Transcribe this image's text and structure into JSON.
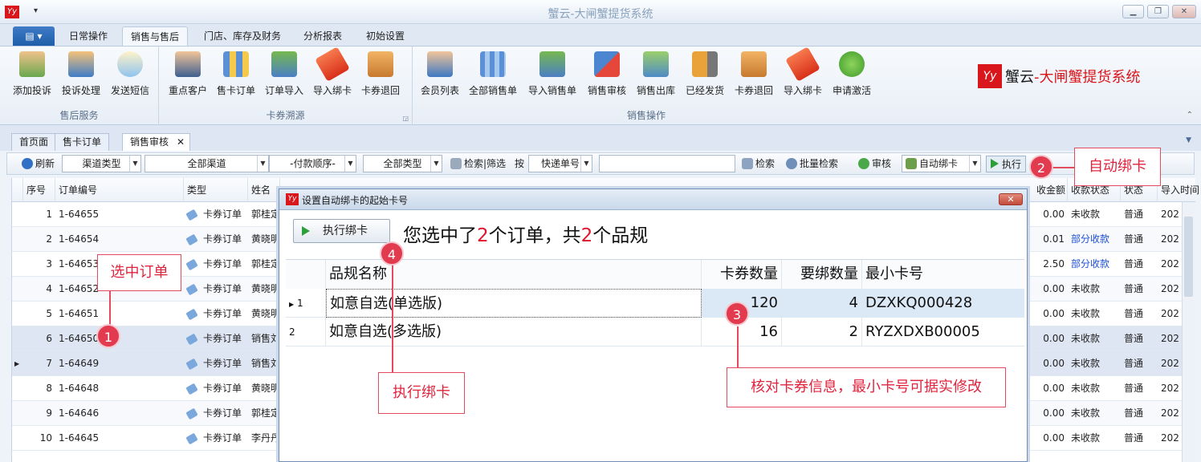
{
  "window": {
    "title": "蟹云-大闸蟹提货系统",
    "logo_text": "Yy",
    "qa": "▾"
  },
  "window_controls": {
    "minimize": "▁",
    "restore": "❐",
    "close": "✕"
  },
  "ribbon_tabs": [
    {
      "label": "日常操作"
    },
    {
      "label": "销售与售后"
    },
    {
      "label": "门店、库存及财务"
    },
    {
      "label": "分析报表"
    },
    {
      "label": "初始设置"
    }
  ],
  "menu_label": "▤ ▾",
  "groups": {
    "aftersale": {
      "title": "售后服务",
      "buttons": [
        "添加投诉",
        "投诉处理",
        "发送短信"
      ]
    },
    "source": {
      "title": "卡券溯源",
      "buttons": [
        "重点客户",
        "售卡订单",
        "订单导入",
        "导入绑卡",
        "卡券退回"
      ]
    },
    "sales": {
      "title": "销售操作",
      "buttons": [
        "会员列表",
        "全部销售单",
        "导入销售单",
        "销售审核",
        "销售出库",
        "已经发货",
        "卡券退回",
        "导入绑卡",
        "申请激活"
      ]
    }
  },
  "brand": {
    "main": "蟹云",
    "sub": "-大闸蟹提货系统"
  },
  "doc_tabs": [
    "首页面",
    "售卡订单",
    "销售审核"
  ],
  "toolbar": {
    "refresh": "刷新",
    "channel_type": "渠道类型",
    "all_channels": "全部渠道",
    "payment_order": "-付款顺序-",
    "all_types": "全部类型",
    "search_filter": "检索|筛选",
    "by": "按",
    "express_no": "快递单号",
    "search": "检索",
    "batch_search": "批量检索",
    "audit": "审核",
    "auto_bind": "自动绑卡",
    "execute": "执行"
  },
  "grid": {
    "headers": {
      "seq": "序号",
      "order_no": "订单编号",
      "type": "类型",
      "name": "姓名",
      "amount": "收金额",
      "collect_status": "收款状态",
      "status": "状态",
      "import_time": "导入时间"
    },
    "rows": [
      {
        "seq": "1",
        "order_no": "1-64655",
        "type": "卡券订单",
        "name": "郭桂定",
        "amount": "0.00",
        "collect": "未收款",
        "status": "普通",
        "time": "202"
      },
      {
        "seq": "2",
        "order_no": "1-64654",
        "type": "卡券订单",
        "name": "黄晓明",
        "amount": "0.01",
        "collect": "部分收款",
        "status": "普通",
        "time": "202"
      },
      {
        "seq": "3",
        "order_no": "1-64653",
        "type": "卡券订单",
        "name": "郭桂定",
        "amount": "2.50",
        "collect": "部分收款",
        "status": "普通",
        "time": "202"
      },
      {
        "seq": "4",
        "order_no": "1-64652",
        "type": "卡券订单",
        "name": "黄晓明",
        "amount": "0.00",
        "collect": "未收款",
        "status": "普通",
        "time": "202"
      },
      {
        "seq": "5",
        "order_no": "1-64651",
        "type": "卡券订单",
        "name": "黄晓明",
        "amount": "0.00",
        "collect": "未收款",
        "status": "普通",
        "time": "202"
      },
      {
        "seq": "6",
        "order_no": "1-64650",
        "type": "卡券订单",
        "name": "销售刘",
        "amount": "0.00",
        "collect": "未收款",
        "status": "普通",
        "time": "202"
      },
      {
        "seq": "7",
        "order_no": "1-64649",
        "type": "卡券订单",
        "name": "销售刘",
        "amount": "0.00",
        "collect": "未收款",
        "status": "普通",
        "time": "202"
      },
      {
        "seq": "8",
        "order_no": "1-64648",
        "type": "卡券订单",
        "name": "黄晓明",
        "amount": "0.00",
        "collect": "未收款",
        "status": "普通",
        "time": "202"
      },
      {
        "seq": "9",
        "order_no": "1-64646",
        "type": "卡券订单",
        "name": "郭桂定",
        "amount": "0.00",
        "collect": "未收款",
        "status": "普通",
        "time": "202"
      },
      {
        "seq": "10",
        "order_no": "1-64645",
        "type": "卡券订单",
        "name": "李丹丹",
        "amount": "0.00",
        "collect": "未收款",
        "status": "普通",
        "time": "202"
      }
    ]
  },
  "dialog": {
    "title": "设置自动绑卡的起始卡号",
    "close": "✕",
    "exec_button": "执行绑卡",
    "msg_prefix": "您选中了",
    "order_count": "2",
    "msg_mid": "个订单，共",
    "spec_count": "2",
    "msg_suffix": "个品规",
    "headers": {
      "name": "品规名称",
      "qty": "卡券数量",
      "bind": "要绑数量",
      "min": "最小卡号"
    },
    "rows": [
      {
        "idx": "1",
        "name": "如意自选(单选版)",
        "qty": "120",
        "bind": "4",
        "min": "DZXKQ000428"
      },
      {
        "idx": "2",
        "name": "如意自选(多选版)",
        "qty": "16",
        "bind": "2",
        "min": "RYZXDXB00005"
      }
    ]
  },
  "annotations": {
    "select_order": "选中订单",
    "auto_bind": "自动绑卡",
    "exec_bind": "执行绑卡",
    "verify": "核对卡券信息，最小卡号可据实修改",
    "b1": "1",
    "b2": "2",
    "b3": "3",
    "b4": "4"
  }
}
